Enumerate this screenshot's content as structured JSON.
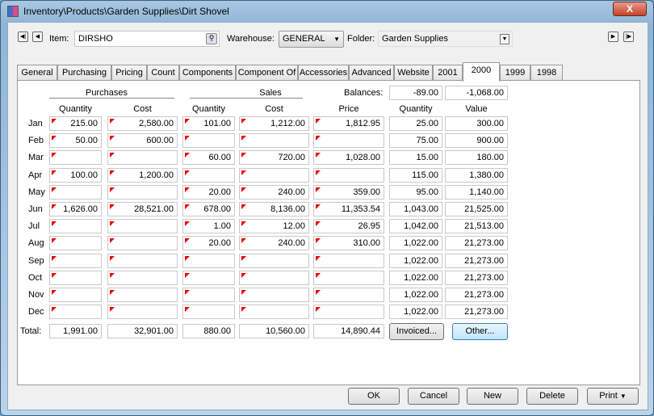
{
  "window": {
    "title": "Inventory\\Products\\Garden Supplies\\Dirt Shovel",
    "close": "X"
  },
  "header": {
    "item_label": "Item:",
    "item_value": "DIRSHO",
    "warehouse_label": "Warehouse:",
    "warehouse_value": "GENERAL",
    "folder_label": "Folder:",
    "folder_value": "Garden Supplies"
  },
  "tabs": [
    "General",
    "Purchasing",
    "Pricing",
    "Count",
    "Components",
    "Component Of",
    "Accessories",
    "Advanced",
    "Website",
    "2001",
    "2000",
    "1999",
    "1998"
  ],
  "active_tab": "2000",
  "grid": {
    "purchases_header": "Purchases",
    "sales_header": "Sales",
    "balances_label": "Balances:",
    "balances": [
      "-89.00",
      "-1,068.00"
    ],
    "columns": [
      "Quantity",
      "Cost",
      "Quantity",
      "Cost",
      "Price",
      "Quantity",
      "Value"
    ],
    "rows": [
      {
        "month": "Jan",
        "values": [
          "215.00",
          "2,580.00",
          "101.00",
          "1,212.00",
          "1,812.95",
          "25.00",
          "300.00"
        ]
      },
      {
        "month": "Feb",
        "values": [
          "50.00",
          "600.00",
          "",
          "",
          "",
          "75.00",
          "900.00"
        ]
      },
      {
        "month": "Mar",
        "values": [
          "",
          "",
          "60.00",
          "720.00",
          "1,028.00",
          "15.00",
          "180.00"
        ]
      },
      {
        "month": "Apr",
        "values": [
          "100.00",
          "1,200.00",
          "",
          "",
          "",
          "115.00",
          "1,380.00"
        ]
      },
      {
        "month": "May",
        "values": [
          "",
          "",
          "20.00",
          "240.00",
          "359.00",
          "95.00",
          "1,140.00"
        ]
      },
      {
        "month": "Jun",
        "values": [
          "1,626.00",
          "28,521.00",
          "678.00",
          "8,136.00",
          "11,353.54",
          "1,043.00",
          "21,525.00"
        ]
      },
      {
        "month": "Jul",
        "values": [
          "",
          "",
          "1.00",
          "12.00",
          "26.95",
          "1,042.00",
          "21,513.00"
        ]
      },
      {
        "month": "Aug",
        "values": [
          "",
          "",
          "20.00",
          "240.00",
          "310.00",
          "1,022.00",
          "21,273.00"
        ]
      },
      {
        "month": "Sep",
        "values": [
          "",
          "",
          "",
          "",
          "",
          "1,022.00",
          "21,273.00"
        ]
      },
      {
        "month": "Oct",
        "values": [
          "",
          "",
          "",
          "",
          "",
          "1,022.00",
          "21,273.00"
        ]
      },
      {
        "month": "Nov",
        "values": [
          "",
          "",
          "",
          "",
          "",
          "1,022.00",
          "21,273.00"
        ]
      },
      {
        "month": "Dec",
        "values": [
          "",
          "",
          "",
          "",
          "",
          "1,022.00",
          "21,273.00"
        ]
      }
    ],
    "total_label": "Total:",
    "totals": [
      "1,991.00",
      "32,901.00",
      "880.00",
      "10,560.00",
      "14,890.44"
    ],
    "invoiced_button": "Invoiced...",
    "other_button": "Other..."
  },
  "footer": {
    "ok": "OK",
    "cancel": "Cancel",
    "new": "New",
    "delete": "Delete",
    "print": "Print"
  }
}
